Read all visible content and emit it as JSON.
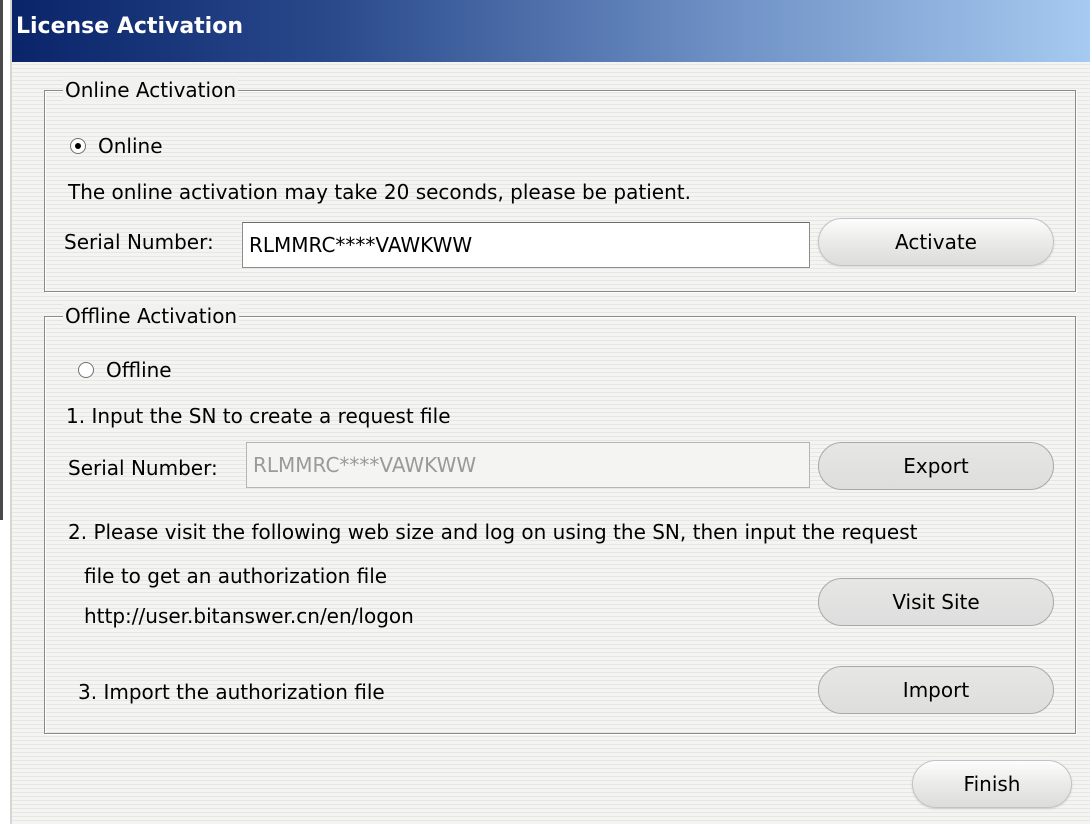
{
  "window": {
    "title": "License Activation"
  },
  "online": {
    "group_label": "Online Activation",
    "radio_label": "Online",
    "radio_checked": true,
    "info_text": "The online activation may take 20 seconds, please be patient.",
    "serial_label": "Serial Number:",
    "serial_value": "RLMMRC****VAWKWW",
    "activate_label": "Activate"
  },
  "offline": {
    "group_label": "Offline Activation",
    "radio_label": "Offline",
    "radio_checked": false,
    "step1_text": "1. Input the SN to create a request file",
    "serial_label": "Serial Number:",
    "serial_value": "RLMMRC****VAWKWW",
    "export_label": "Export",
    "step2_line1": "2. Please visit the following web size and log on using the SN, then input the request",
    "step2_line2": "file to get an authorization file",
    "url": "http://user.bitanswer.cn/en/logon",
    "visit_label": "Visit Site",
    "step3_text": "3. Import the authorization file",
    "import_label": "Import"
  },
  "footer": {
    "finish_label": "Finish"
  },
  "colors": {
    "title_start": "#0a246a",
    "title_end": "#a6caf0",
    "background": "#f1f1ee"
  }
}
